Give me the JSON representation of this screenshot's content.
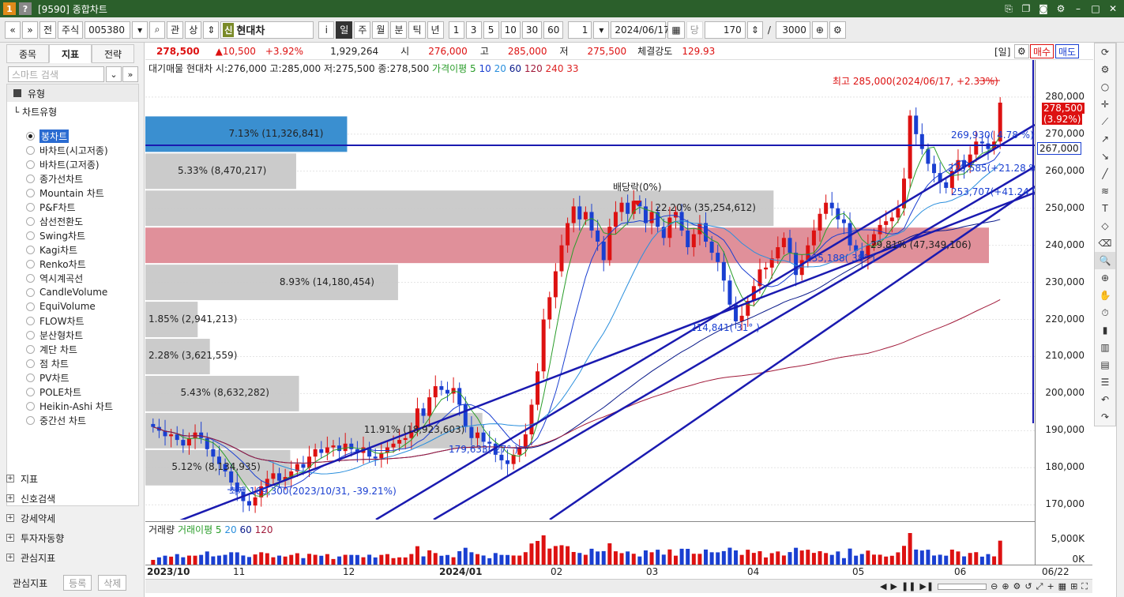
{
  "window": {
    "title": "[9590] 종합차트",
    "icon_1": "1",
    "icon_2": "?"
  },
  "toolbar": {
    "nav_prev": "«",
    "nav_next": "»",
    "market_btn": "전",
    "type_select": "주식",
    "code_value": "005380",
    "search_icon": "search-icon",
    "btn_gwan": "관",
    "btn_sang": "상",
    "stock_prefix": "신",
    "stock_name": "현대차",
    "info_btn": "i",
    "periods": [
      "일",
      "주",
      "월",
      "분",
      "틱",
      "년"
    ],
    "intervals": [
      "1",
      "3",
      "5",
      "10",
      "30",
      "60"
    ],
    "interval_value": "1",
    "date_value": "2024/06/17",
    "count_label": "당",
    "count_value": "170",
    "slash": "/",
    "total_value": "3000"
  },
  "left_panel": {
    "tabs": [
      "종목",
      "지표",
      "전략"
    ],
    "active_tab": "지표",
    "search_placeholder": "스마트 검색",
    "category": "유형",
    "sub_category": "차트유형",
    "chart_types": [
      "봉차트",
      "바차트(시고저종)",
      "바차트(고저종)",
      "종가선차트",
      "Mountain 차트",
      "P&F차트",
      "삼선전환도",
      "Swing차트",
      "Kagi차트",
      "Renko차트",
      "역시계곡선",
      "CandleVolume",
      "EquiVolume",
      "FLOW차트",
      "분산형차트",
      "계단 차트",
      "점 차트",
      "PV차트",
      "POLE차트",
      "Heikin-Ashi 차트",
      "중간선 차트"
    ],
    "selected_chart_type": "봉차트",
    "groups": [
      "지표",
      "신호검색",
      "강세약세",
      "투자자동향",
      "관심지표"
    ],
    "bottom_label": "관심지표",
    "btn_register": "등록",
    "btn_delete": "삭제"
  },
  "quote": {
    "price": "278,500",
    "change": "▲10,500",
    "change_pct": "+3.92%",
    "volume": "1,929,264",
    "open_label": "시",
    "open": "276,000",
    "high_label": "고",
    "high": "285,000",
    "low_label": "저",
    "low": "275,500",
    "strength_label": "체결강도",
    "strength": "129.93",
    "period_btn": "[일]",
    "buy_btn": "매수",
    "sell_btn": "매도"
  },
  "chart_info": {
    "prefix": "대기매물",
    "summary": "현대차 시:276,000 고:285,000 저:275,500 종:278,500",
    "ma_label": "가격이평 5",
    "ma_periods": [
      "10",
      "20",
      "60",
      "120",
      "240",
      "33"
    ],
    "high_note": "최고 285,000(2024/06/17, +2.33%)",
    "low_note": "최저 169,300(2023/10/31, -39.21%)",
    "dividend_note": "배당락(0%)",
    "current_price_tag": "278,500",
    "current_pct_tag": "(3.92%)",
    "line_price_tag": "267,000",
    "trend_labels": [
      "269,930( 4.78 %)",
      "229,585(+21.28 %)",
      "253,707(+41.24 %)",
      "214,841( 31° )",
      "235,188( 38° )",
      "179,633( 27° )"
    ]
  },
  "volume_info": {
    "title": "거래량",
    "ma_label": "거래이평 5",
    "ma_periods": [
      "20",
      "60",
      "120"
    ],
    "axis_label": "5,000K",
    "zero_label": "0K"
  },
  "x_axis": {
    "labels": [
      "2023/10",
      "11",
      "12",
      "2024/01",
      "02",
      "03",
      "04",
      "05",
      "06"
    ],
    "end_label": "06/22"
  },
  "y_axis": {
    "labels": [
      "280,000",
      "270,000",
      "260,000",
      "250,000",
      "240,000",
      "230,000",
      "220,000",
      "210,000",
      "200,000",
      "190,000",
      "180,000",
      "170,000"
    ]
  },
  "colors": {
    "up": "#dd1111",
    "down": "#1a3fd1",
    "profile": "#c8c8c8",
    "profile_blue": "#3a8fd0",
    "profile_red": "#e0909a",
    "ma5": "#2a9d2a",
    "ma10": "#1a3fd1",
    "ma20": "#2a8fdd",
    "ma60": "#0a1a8a",
    "ma120": "#a11a3a",
    "ma240": "#dd2222"
  },
  "chart_data": {
    "type": "candlestick",
    "ylim": [
      166000,
      290000
    ],
    "volume_profile": [
      {
        "from": 265000,
        "to": 275000,
        "pct": "7.13%",
        "volume": "11,326,841",
        "style": "blue"
      },
      {
        "from": 255000,
        "to": 265000,
        "pct": "5.33%",
        "volume": "8,470,217",
        "style": "gray"
      },
      {
        "from": 245000,
        "to": 255000,
        "pct": "22.20%",
        "volume": "35,254,612",
        "style": "gray"
      },
      {
        "from": 235000,
        "to": 245000,
        "pct": "29.81%",
        "volume": "47,349,106",
        "style": "red"
      },
      {
        "from": 225000,
        "to": 235000,
        "pct": "8.93%",
        "volume": "14,180,454",
        "style": "gray"
      },
      {
        "from": 215000,
        "to": 225000,
        "pct": "1.85%",
        "volume": "2,941,213",
        "style": "gray"
      },
      {
        "from": 205000,
        "to": 215000,
        "pct": "2.28%",
        "volume": "3,621,559",
        "style": "gray"
      },
      {
        "from": 195000,
        "to": 205000,
        "pct": "5.43%",
        "volume": "8,632,282",
        "style": "gray"
      },
      {
        "from": 185000,
        "to": 195000,
        "pct": "11.91%",
        "volume": "18,923,603",
        "style": "gray"
      },
      {
        "from": 175000,
        "to": 185000,
        "pct": "5.12%",
        "volume": "8,134,935",
        "style": "gray"
      }
    ],
    "closes": [
      191000,
      190000,
      188500,
      189000,
      187500,
      186000,
      188000,
      189500,
      188000,
      185000,
      183000,
      181000,
      179000,
      176000,
      173500,
      171000,
      169800,
      172000,
      175000,
      177000,
      178500,
      176500,
      177500,
      179000,
      181000,
      180000,
      183000,
      185000,
      184000,
      185500,
      186000,
      184500,
      186500,
      185000,
      184000,
      185500,
      183000,
      182500,
      184000,
      185500,
      186500,
      187500,
      188000,
      190000,
      196000,
      194000,
      199000,
      202000,
      201000,
      200000,
      201500,
      197000,
      191000,
      188000,
      189500,
      187000,
      186500,
      183500,
      182000,
      181000,
      183500,
      185500,
      189000,
      197000,
      206000,
      220000,
      226000,
      233000,
      240000,
      246000,
      250500,
      247000,
      249000,
      244000,
      241000,
      236000,
      245000,
      249000,
      251500,
      248500,
      252000,
      250500,
      246000,
      249000,
      245000,
      242000,
      247500,
      249000,
      244000,
      239500,
      243000,
      246000,
      241000,
      238000,
      235500,
      230500,
      224000,
      219500,
      221000,
      225000,
      229000,
      233500,
      234000,
      236500,
      239500,
      242000,
      238000,
      232000,
      236000,
      240000,
      244000,
      248500,
      251500,
      250000,
      247000,
      246000,
      240000,
      238500,
      236500,
      240000,
      243000,
      245500,
      246500,
      247500,
      250000,
      258000,
      275000,
      270000,
      266000,
      262000,
      259500,
      257000,
      255500,
      260000,
      263000,
      261000,
      264500,
      268000,
      267500,
      266000,
      268000,
      278500
    ]
  }
}
